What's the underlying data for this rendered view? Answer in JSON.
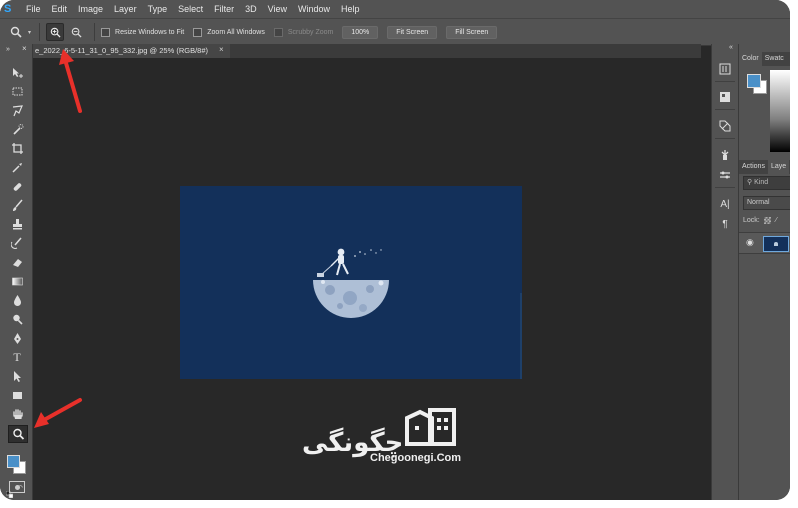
{
  "app": {
    "logo": "S",
    "accent_color": "#31a8ff"
  },
  "menubar": {
    "items": [
      "File",
      "Edit",
      "Image",
      "Layer",
      "Type",
      "Select",
      "Filter",
      "3D",
      "View",
      "Window",
      "Help"
    ]
  },
  "options_bar": {
    "tool_icon": "zoom-icon",
    "zoom_in_icon": "zoom-in-icon",
    "zoom_out_icon": "zoom-out-icon",
    "resize_windows_label": "Resize Windows to Fit",
    "zoom_all_windows_label": "Zoom All Windows",
    "scrubby_zoom_label": "Scrubby Zoom",
    "zoom_100_label": "100%",
    "fit_screen_label": "Fit Screen",
    "fill_screen_label": "Fill Screen"
  },
  "toolbar": {
    "collapse_label": "»",
    "close_label": "×",
    "tools": [
      "move-tool",
      "marquee-tool",
      "lasso-tool",
      "quick-selection-tool",
      "crop-tool",
      "eyedropper-tool",
      "healing-brush-tool",
      "brush-tool",
      "clone-stamp-tool",
      "history-brush-tool",
      "eraser-tool",
      "gradient-tool",
      "blur-tool",
      "dodge-tool",
      "pen-tool",
      "type-tool",
      "path-selection-tool",
      "rectangle-tool",
      "hand-tool",
      "zoom-tool"
    ],
    "type_tool_glyph": "T",
    "foreground_color": "#4a90c8",
    "background_color": "#ffffff"
  },
  "document": {
    "tab_title": "e_2022_6-5-11_31_0_95_332.jpg @ 25% (RGB/8#)",
    "close_label": "×",
    "image_background": "#13305a"
  },
  "dock": {
    "collapse_label": "«",
    "type_glyph": "A|",
    "paragraph_glyph": "¶"
  },
  "panels": {
    "color_tab": "Color",
    "swatches_tab": "Swatc",
    "actions_tab": "Actions",
    "layers_tab": "Laye",
    "kind_placeholder": "Kind",
    "blend_mode": "Normal",
    "lock_label": "Lock:"
  },
  "watermark": {
    "text": "چگونگی",
    "domain": "Chegoonegi.Com"
  },
  "annotation": {
    "arrow_color": "#e8302a"
  }
}
